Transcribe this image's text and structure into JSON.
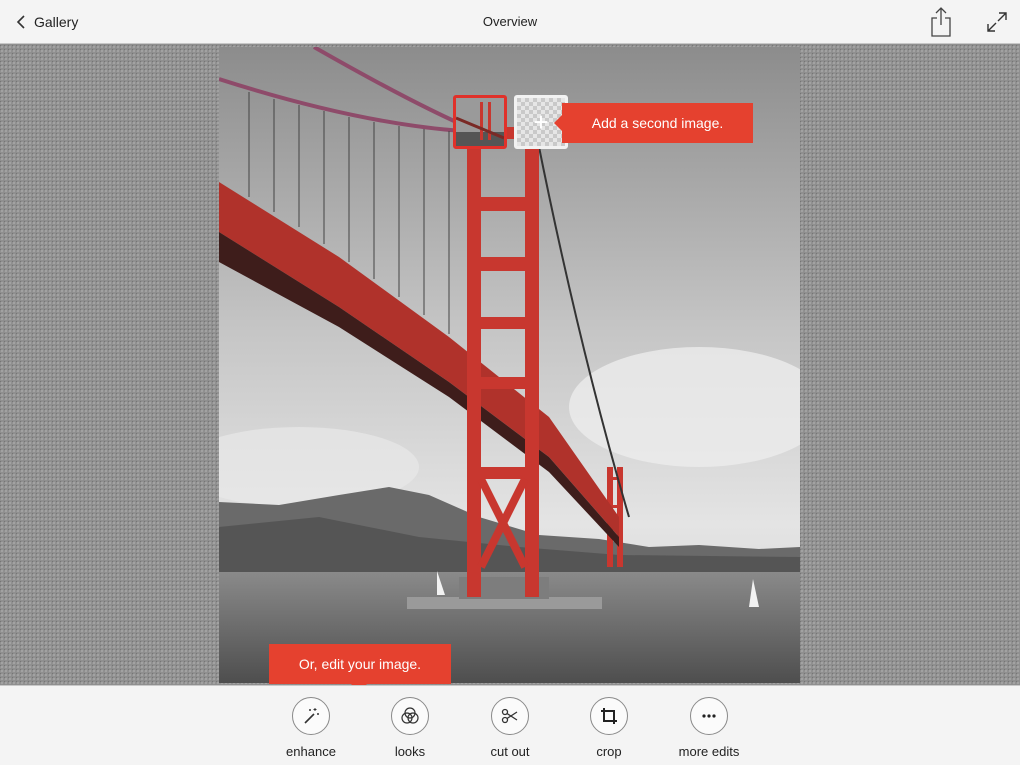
{
  "header": {
    "back_label": "Gallery",
    "title": "Overview",
    "icons": {
      "back": "chevron-left-icon",
      "share": "share-icon",
      "expand": "expand-icon"
    }
  },
  "thumbnails": {
    "add_symbol": "+"
  },
  "tooltips": {
    "add_image": "Add a second image.",
    "edit_image": "Or, edit your image."
  },
  "toolbar": {
    "tools": [
      {
        "label": "enhance",
        "icon": "magic-wand-icon"
      },
      {
        "label": "looks",
        "icon": "looks-circles-icon"
      },
      {
        "label": "cut out",
        "icon": "scissors-icon"
      },
      {
        "label": "crop",
        "icon": "crop-icon"
      },
      {
        "label": "more edits",
        "icon": "more-dots-icon"
      }
    ]
  },
  "colors": {
    "accent": "#e5412f",
    "bridge": "#c8372f",
    "bar": "#f4f4f4"
  }
}
